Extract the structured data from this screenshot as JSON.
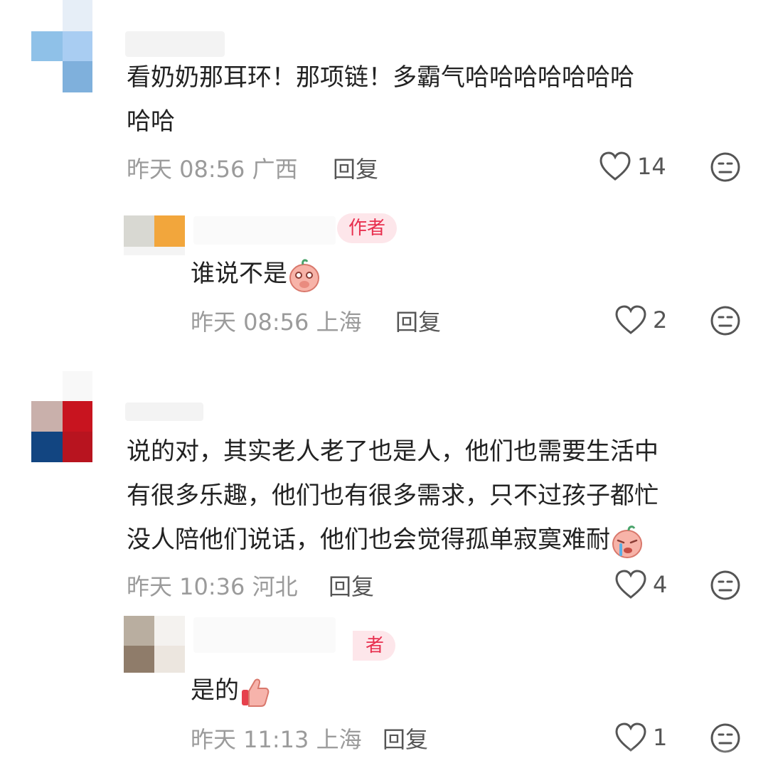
{
  "comments": [
    {
      "text_lines": [
        "看奶奶那耳环！那项链！多霸气哈哈哈哈哈哈哈",
        "哈哈"
      ],
      "time": "昨天 08:56",
      "location": "广西",
      "reply_label": "回复",
      "likes": "14",
      "replies": [
        {
          "badge": "作者",
          "text": "谁说不是",
          "emoji": "peach-cover-mouth-icon",
          "time": "昨天 08:56",
          "location": "上海",
          "reply_label": "回复",
          "likes": "2"
        }
      ]
    },
    {
      "text_lines": [
        "说的对，其实老人老了也是人，他们也需要生活中",
        "有很多乐趣，他们也有很多需求，只不过孩子都忙",
        "没人陪他们说话，他们也会觉得孤单寂寞难耐"
      ],
      "emoji": "peach-crying-icon",
      "time": "昨天 10:36",
      "location": "河北",
      "reply_label": "回复",
      "likes": "4",
      "replies": [
        {
          "badge": "者",
          "text": "是的",
          "emoji": "thumbs-up-icon",
          "time": "昨天 11:13",
          "location": "上海",
          "reply_label": "回复",
          "likes": "1"
        }
      ]
    }
  ],
  "colors": {
    "badge_bg": "#fde6ea",
    "badge_text": "#e8304f",
    "meta_text": "#9b9b9b",
    "body_text": "#222222"
  }
}
